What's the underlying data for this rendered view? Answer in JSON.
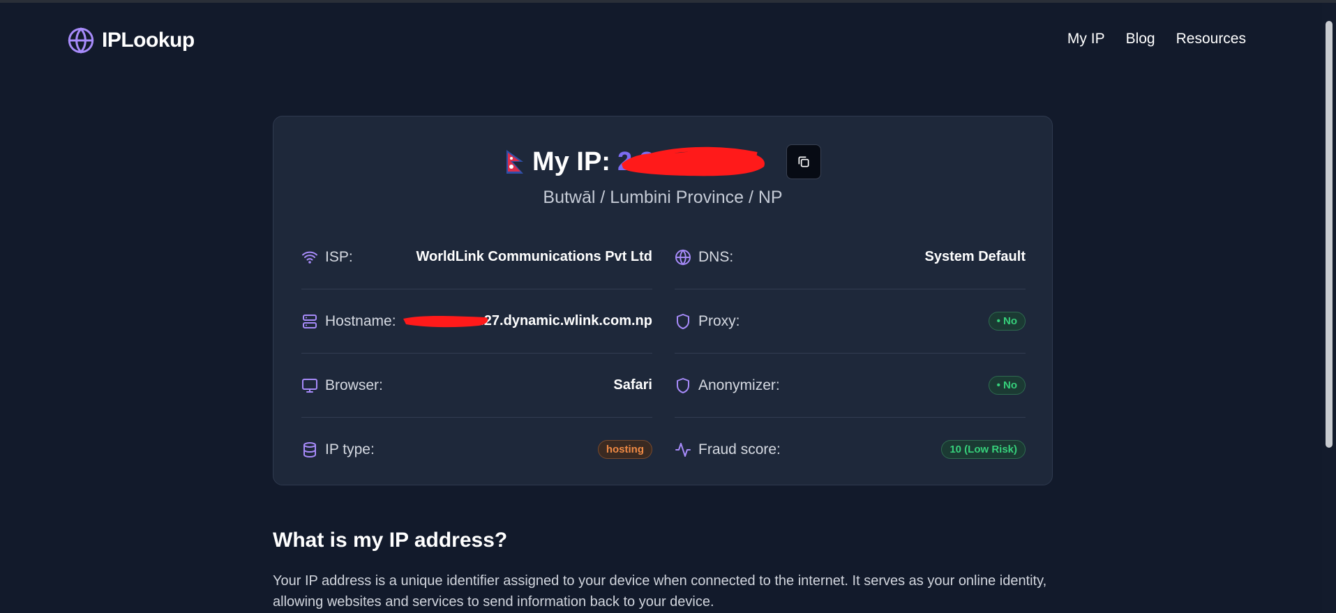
{
  "brand": {
    "name": "IPLookup",
    "icon": "globe-icon",
    "accent": "#a78bfa"
  },
  "nav": [
    {
      "label": "My IP"
    },
    {
      "label": "Blog"
    },
    {
      "label": "Resources"
    }
  ],
  "ip_card": {
    "flag_icon": "nepal-flag-icon",
    "label": "My IP:",
    "value_visible": "2 3",
    "copy_icon": "copy-icon",
    "location": "Butwāl / Lumbini Province / NP"
  },
  "details_left": [
    {
      "icon": "wifi-icon",
      "label": "ISP:",
      "value": "WorldLink Communications Pvt Ltd"
    },
    {
      "icon": "server-icon",
      "label": "Hostname:",
      "value": ".27.dynamic.wlink.com.np"
    },
    {
      "icon": "monitor-icon",
      "label": "Browser:",
      "value": "Safari"
    },
    {
      "icon": "database-icon",
      "label": "IP type:",
      "value": "hosting"
    }
  ],
  "details_right": [
    {
      "icon": "globe-icon",
      "label": "DNS:",
      "value": "System Default"
    },
    {
      "icon": "shield-icon",
      "label": "Proxy:",
      "value": "• No"
    },
    {
      "icon": "shield-icon",
      "label": "Anonymizer:",
      "value": "• No"
    },
    {
      "icon": "activity-icon",
      "label": "Fraud score:",
      "value": "10 (Low Risk)"
    }
  ],
  "colors": {
    "good": "#36d07b",
    "warn": "#f08a45",
    "ip": "#7c6cf2"
  },
  "article": {
    "title": "What is my IP address?",
    "body": "Your IP address is a unique identifier assigned to your device when connected to the internet. It serves as your online identity, allowing websites and services to send information back to your device."
  }
}
